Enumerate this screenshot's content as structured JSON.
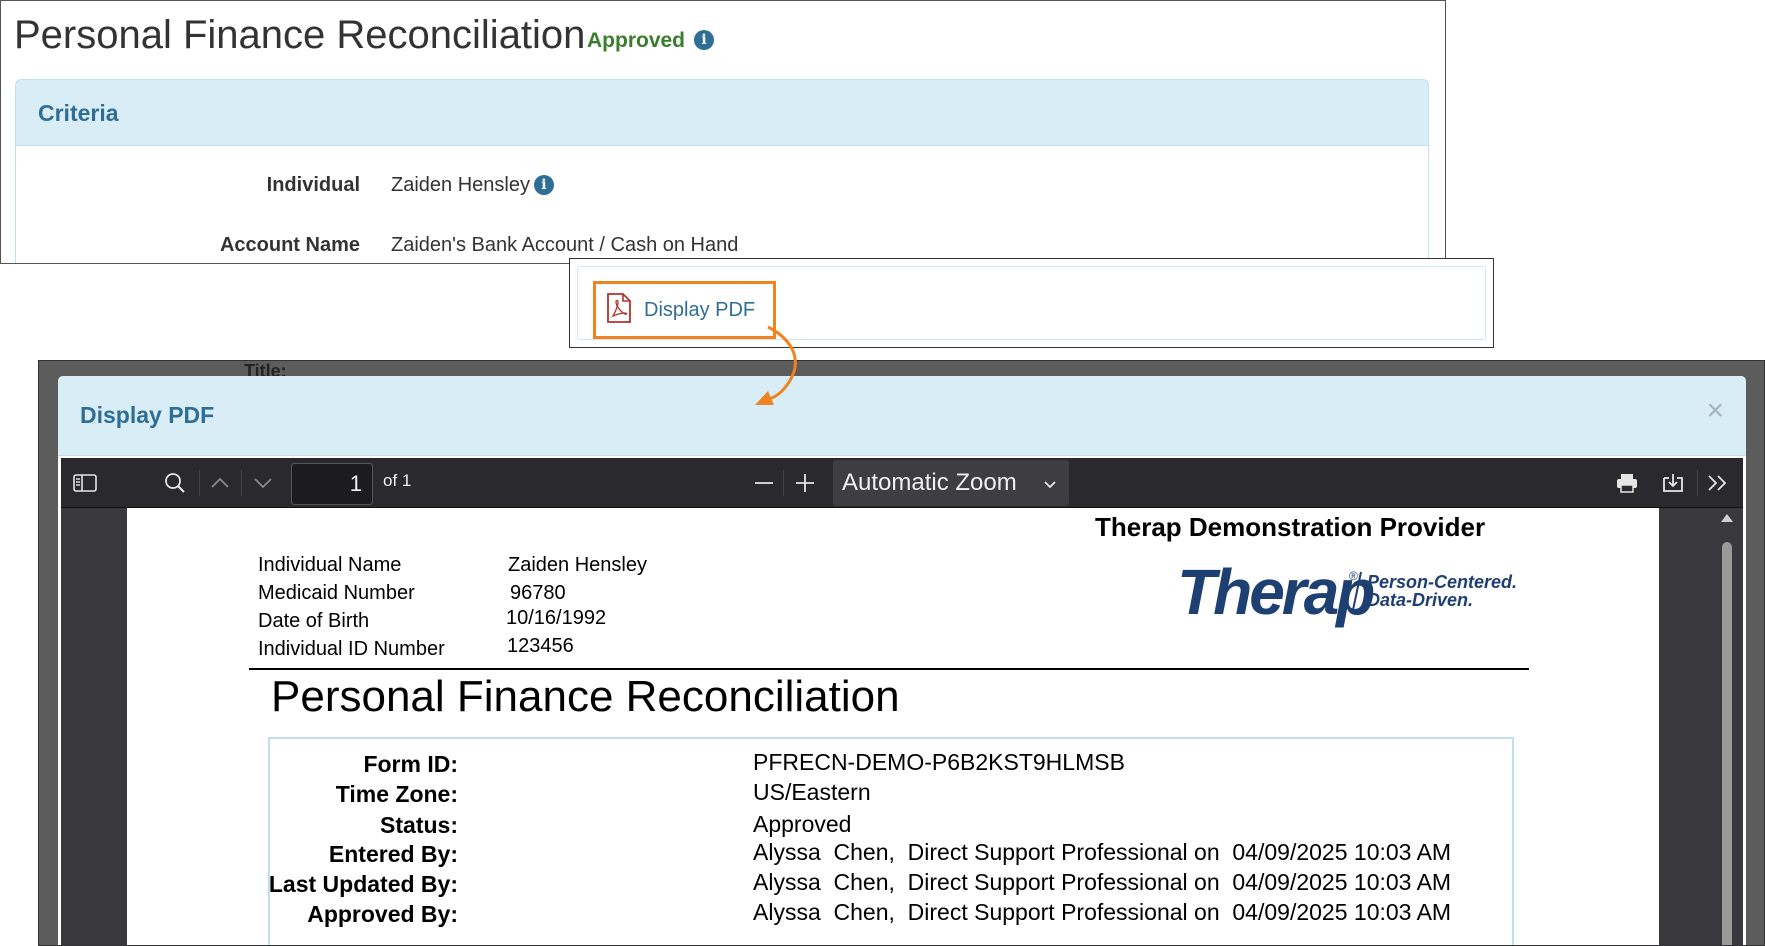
{
  "top": {
    "title": "Personal Finance Reconciliation",
    "status": "Approved",
    "criteria": {
      "header": "Criteria",
      "rows": [
        {
          "label": "Individual",
          "value": "Zaiden Hensley"
        },
        {
          "label": "Account Name",
          "value": "Zaiden's Bank Account / Cash on Hand"
        }
      ]
    }
  },
  "link": {
    "label": "Display PDF"
  },
  "background": {
    "partial_label": "Title:"
  },
  "modal": {
    "title": "Display PDF",
    "close": "×",
    "toolbar": {
      "page_number": "1",
      "page_count": "of 1",
      "zoom": "Automatic Zoom"
    },
    "pdf": {
      "provider": "Therap Demonstration Provider",
      "logo_word": "Therap",
      "logo_tagline_1": "Person-Centered.",
      "logo_tagline_2": "Data-Driven.",
      "demographics": [
        {
          "label": "Individual Name",
          "value": "Zaiden Hensley"
        },
        {
          "label": "Medicaid Number",
          "value": "96780"
        },
        {
          "label": "Date of Birth",
          "value": "10/16/1992"
        },
        {
          "label": "Individual ID Number",
          "value": "123456"
        }
      ],
      "heading": "Personal Finance Reconciliation",
      "form_fields": [
        {
          "label": "Form ID:",
          "value": "PFRECN-DEMO-P6B2KST9HLMSB"
        },
        {
          "label": "Time Zone:",
          "value": "US/Eastern"
        },
        {
          "label": "Status:",
          "value": "Approved"
        },
        {
          "label": "Entered By:",
          "value": "Alyssa  Chen,  Direct Support Professional on  04/09/2025 10:03 AM"
        },
        {
          "label": "Last Updated By:",
          "value": "Alyssa  Chen,  Direct Support Professional on  04/09/2025 10:03 AM"
        },
        {
          "label": "Approved By:",
          "value": "Alyssa  Chen,  Direct Support Professional on  04/09/2025 10:03 AM"
        }
      ]
    }
  },
  "colors": {
    "accent_blue": "#2e6e95",
    "header_bg": "#d9edf7",
    "approved_green": "#3a7d2c",
    "highlight_orange": "#f0831f",
    "pdf_icon_red": "#b5322a"
  },
  "icons": [
    "info-icon",
    "pdf-file-icon",
    "sidebar-toggle-icon",
    "search-icon",
    "chevron-up-icon",
    "chevron-down-icon",
    "zoom-out-icon",
    "zoom-in-icon",
    "print-icon",
    "download-icon",
    "tools-icon"
  ]
}
